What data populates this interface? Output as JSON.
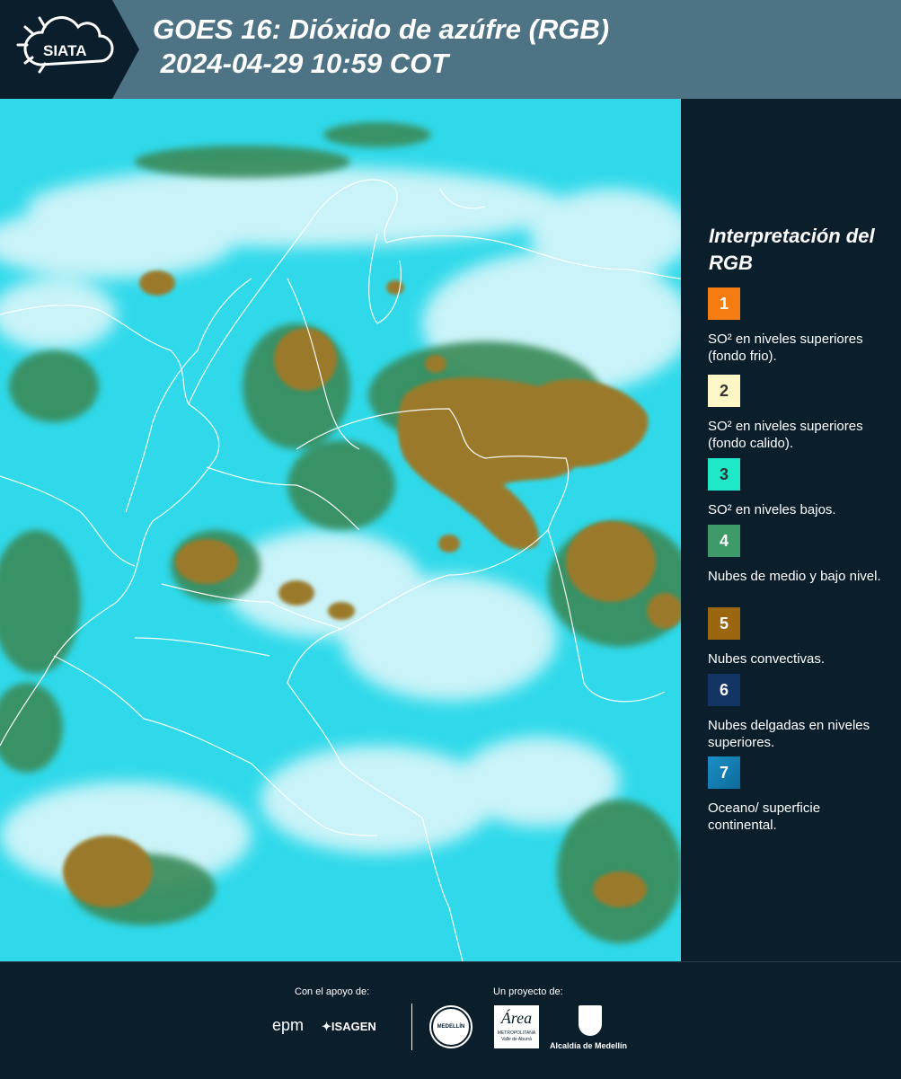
{
  "header": {
    "logo_text": "SIATA",
    "title_line1": "GOES 16: Dióxido de azúfre (RGB)",
    "title_line2": " 2024-04-29 10:59 COT"
  },
  "legend": {
    "title": "Interpretación del RGB",
    "items": [
      {
        "number": "1",
        "label": "SO² en niveles superiores (fondo frio).",
        "color": "#f57c10"
      },
      {
        "number": "2",
        "label": "SO² en niveles superiores (fondo calido).",
        "color": "#fdf7c6"
      },
      {
        "number": "3",
        "label": "SO² en niveles bajos.",
        "color": "#1ee8c8"
      },
      {
        "number": "4",
        "label": "Nubes de medio y bajo nivel.",
        "color": "#3f9a6a"
      },
      {
        "number": "5",
        "label": "Nubes convectivas.",
        "color": "#9c6510"
      },
      {
        "number": "6",
        "label": "Nubes delgadas en niveles superiores.",
        "color": "#123566"
      },
      {
        "number": "7",
        "label": "Oceano/ superficie continental.",
        "color": "#1a8fc8"
      }
    ]
  },
  "footer": {
    "support_label": "Con el apoyo de:",
    "project_label": "Un proyecto de:",
    "sponsor_epm": "epm",
    "sponsor_isagen": "ISAGEN",
    "sponsor_medellin_seal": "MEDELLÍN",
    "sponsor_area": "Área",
    "sponsor_area_sub": "METROPOLITANA",
    "sponsor_area_sub2": "Valle de Aburrá",
    "sponsor_alcaldia": "Alcaldía de Medellín"
  },
  "colors": {
    "header_bg": "#4d7385",
    "panel_bg": "#0b1e2c",
    "map_base": "#2fd9ea",
    "convective": "#9a7a2a",
    "mid_cloud": "#3f8c5a",
    "high_cloud": "#e8f8fb"
  }
}
